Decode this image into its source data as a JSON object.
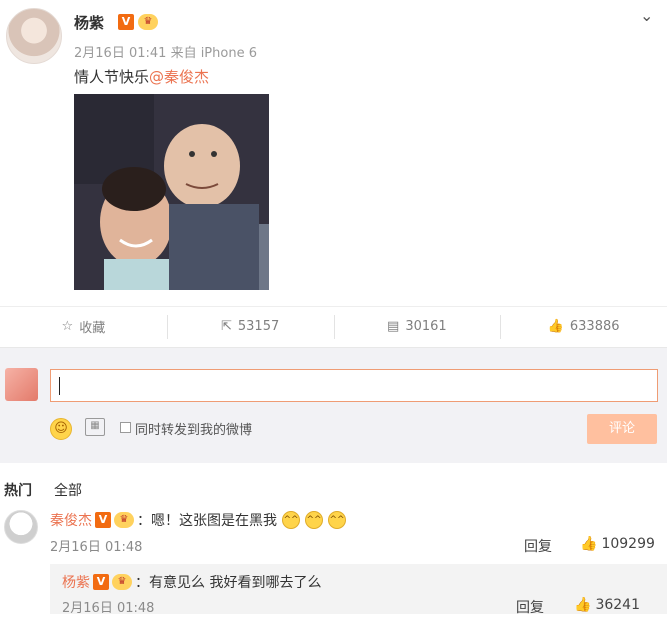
{
  "post": {
    "author": "杨紫",
    "badge_v": "V",
    "timestamp": "2月16日 01:41",
    "source": "来自 iPhone 6",
    "text": "情人节快乐",
    "mention": "@秦俊杰"
  },
  "actions": {
    "favorite": "收藏",
    "repost_count": "53157",
    "comment_count": "30161",
    "like_count": "633886"
  },
  "composer": {
    "checkbox_label": "同时转发到我的微博",
    "submit_label": "评论"
  },
  "comment_tabs": {
    "hot": "热门",
    "all": "全部"
  },
  "comments": [
    {
      "user": "秦俊杰",
      "text": "：嗯！这张图是在黑我",
      "time": "2月16日 01:48",
      "reply": "回复",
      "likes": "109299"
    },
    {
      "user": "杨紫",
      "text": "：有意见么 我好看到哪去了么",
      "time": "2月16日 01:48",
      "reply": "回复",
      "likes": "36241"
    }
  ],
  "colors": {
    "accent": "#eb7350",
    "submit_bg": "#ffc09f",
    "badge_v": "#f26b11"
  }
}
